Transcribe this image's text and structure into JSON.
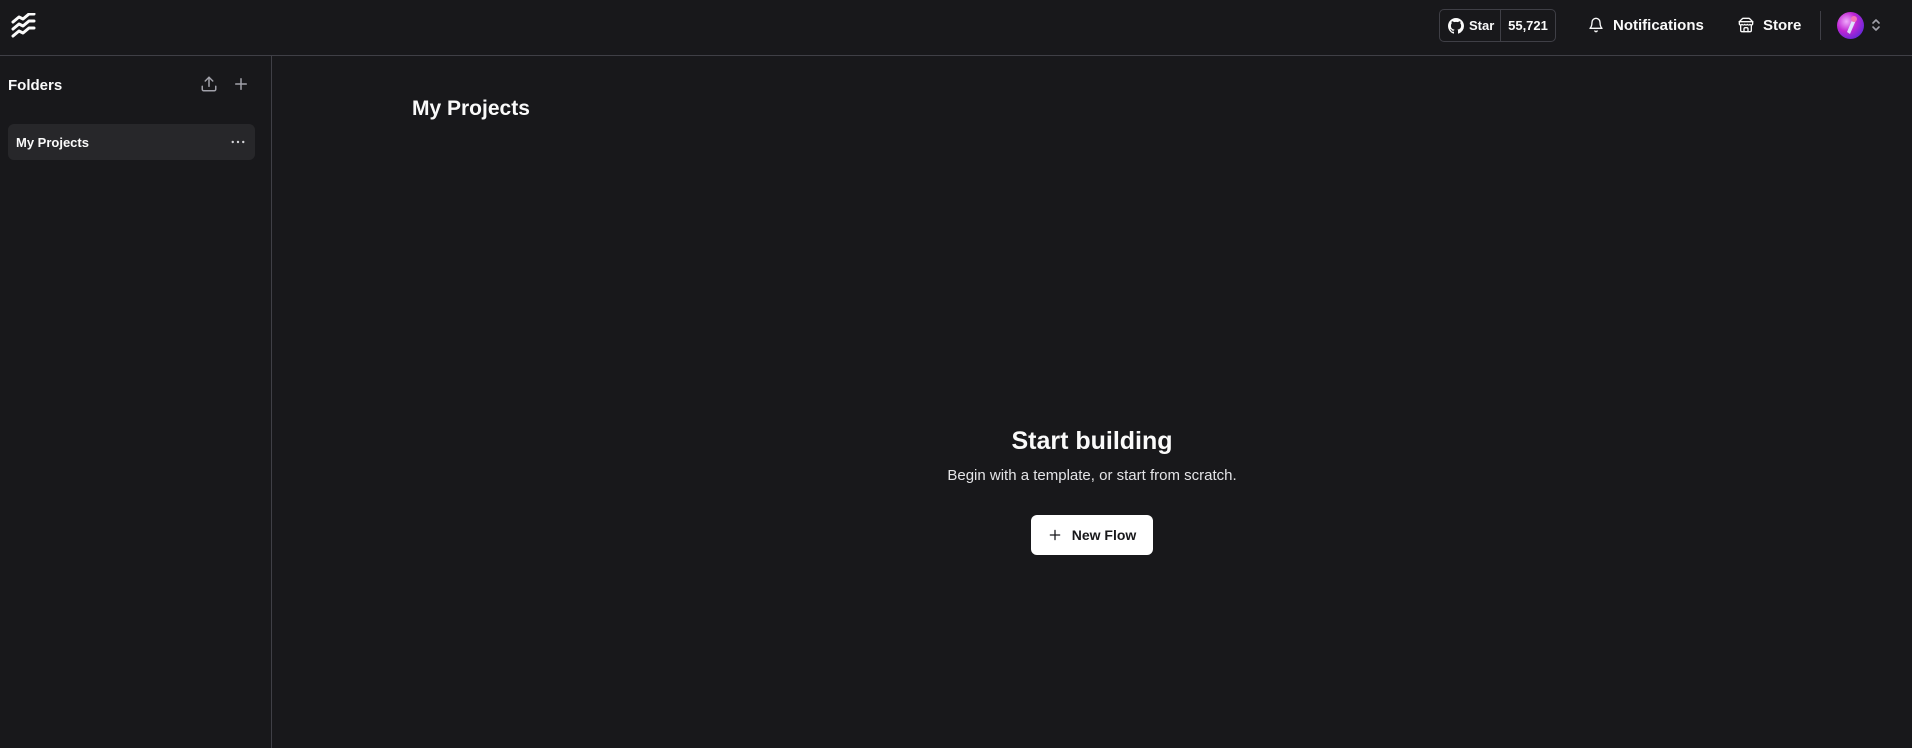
{
  "header": {
    "logo_icon": "langflow-logo-icon",
    "github": {
      "icon": "github-icon",
      "star_label": "Star",
      "star_count": "55,721"
    },
    "notifications_label": "Notifications",
    "notifications_icon": "bell-icon",
    "store_label": "Store",
    "store_icon": "store-icon",
    "avatar_icon": "avatar",
    "menu_caret_icon": "chevrons-up-down-icon"
  },
  "sidebar": {
    "title": "Folders",
    "upload_icon": "upload-icon",
    "add_icon": "plus-icon",
    "folders": [
      {
        "label": "My Projects",
        "active": true,
        "menu_icon": "more-horizontal-icon"
      }
    ]
  },
  "main": {
    "page_title": "My Projects",
    "empty_state": {
      "title": "Start building",
      "subtitle": "Begin with a template, or start from scratch.",
      "button_label": "New Flow",
      "button_icon": "plus-icon"
    }
  },
  "colors": {
    "background": "#18181b",
    "border": "#3f3f46",
    "active_item": "#27272a",
    "text": "#fafafa",
    "button_bg": "#ffffff",
    "button_text": "#18181b"
  }
}
